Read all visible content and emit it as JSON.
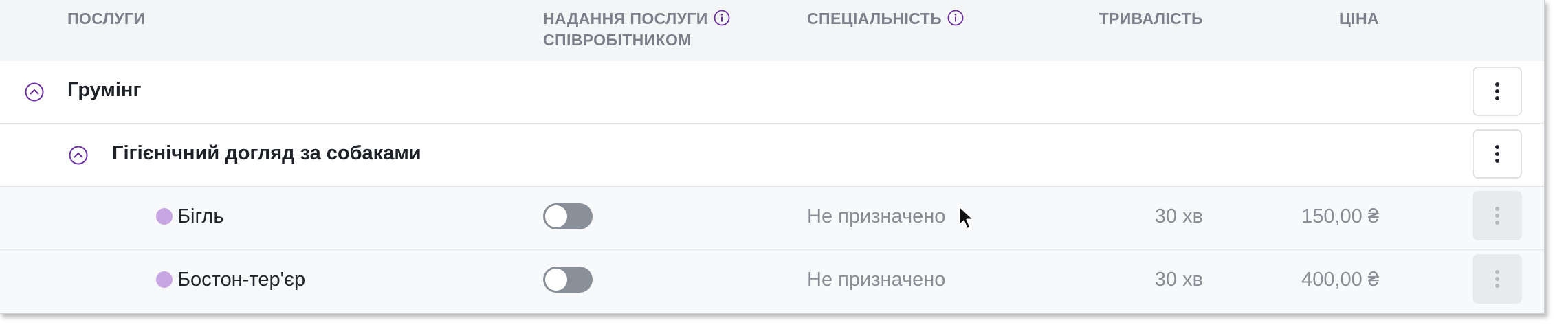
{
  "columns": {
    "services": "ПОСЛУГИ",
    "employee_service_line1": "НАДАННЯ ПОСЛУГИ",
    "employee_service_line2": "СПІВРОБІТНИКОМ",
    "specialty": "СПЕЦІАЛЬНІСТЬ",
    "duration": "ТРИВАЛІСТЬ",
    "price": "ЦІНА"
  },
  "category": {
    "name": "Грумінг",
    "expanded": true
  },
  "subcategory": {
    "name": "Гігієнічний догляд за собаками",
    "expanded": true
  },
  "services": [
    {
      "name": "Бігль",
      "employee_provides": false,
      "specialty": "Не призначено",
      "duration": "30 хв",
      "price": "150,00 ₴",
      "dot_color": "#c8a5e3"
    },
    {
      "name": "Бостон-тер'єр",
      "employee_provides": false,
      "specialty": "Не призначено",
      "duration": "30 хв",
      "price": "400,00 ₴",
      "dot_color": "#c8a5e3"
    }
  ],
  "icons": {
    "info": "info-icon",
    "collapse": "chevron-up-circle-icon",
    "menu": "kebab-menu-icon",
    "cursor": "mouse-pointer-icon"
  },
  "colors": {
    "accent": "#6b2fa0",
    "header_bg": "#f4f5f7",
    "toggle_off": "#8a9099"
  }
}
